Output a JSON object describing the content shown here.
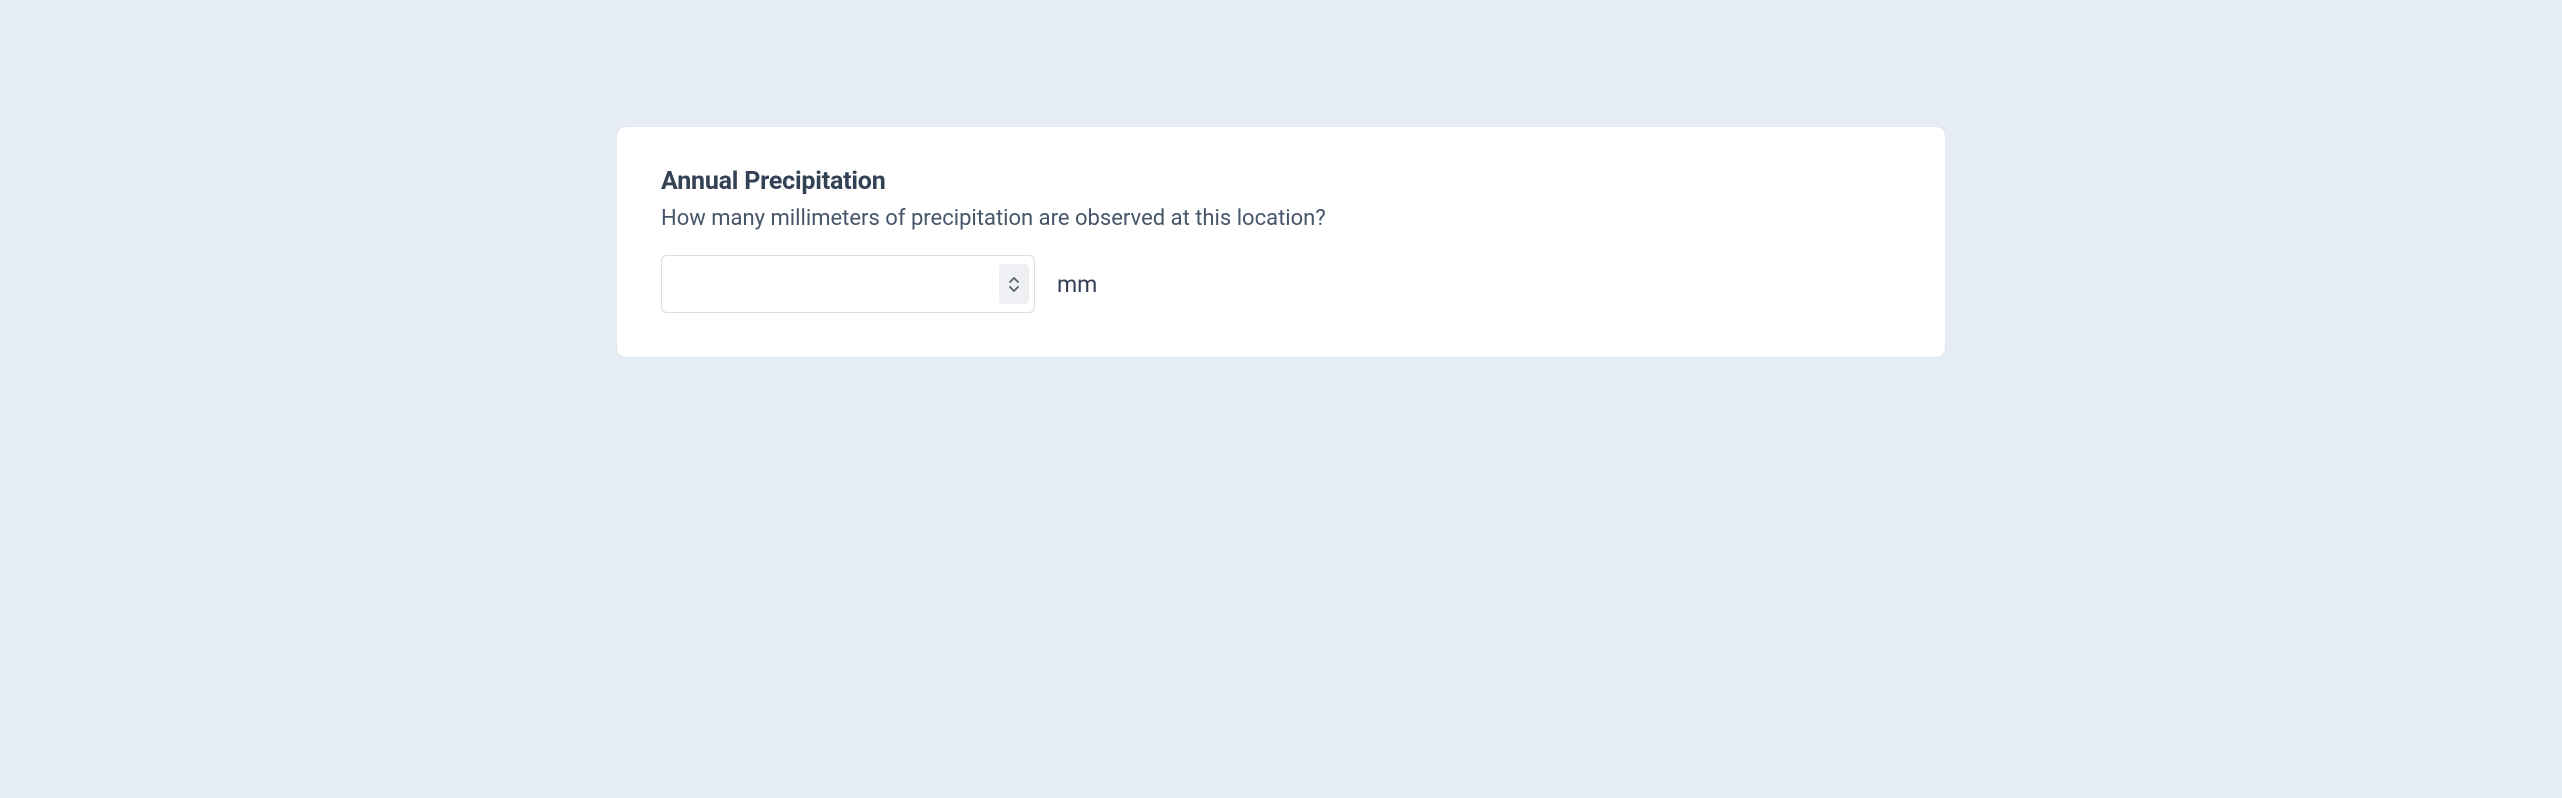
{
  "form": {
    "title": "Annual Precipitation",
    "description": "How many millimeters of precipitation are observed at this location?",
    "input": {
      "value": "",
      "unit": "mm"
    }
  }
}
